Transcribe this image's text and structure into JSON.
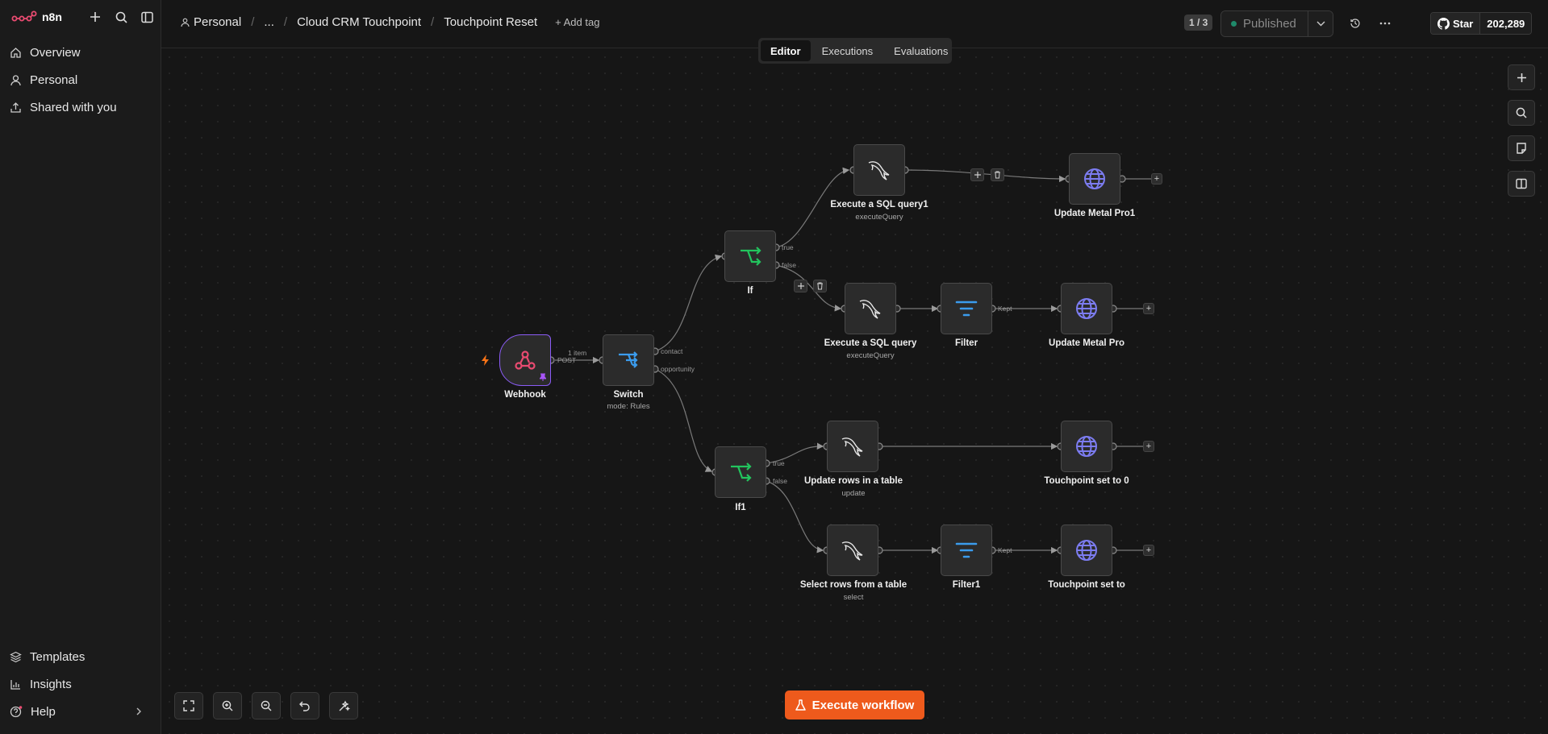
{
  "app": {
    "logo_text": "n8n"
  },
  "sidebar": {
    "items": [
      {
        "label": "Overview",
        "icon": "home-icon"
      },
      {
        "label": "Personal",
        "icon": "user-icon"
      },
      {
        "label": "Shared with you",
        "icon": "share-icon"
      }
    ],
    "bottom_items": [
      {
        "label": "Templates",
        "icon": "templates-icon"
      },
      {
        "label": "Insights",
        "icon": "insights-icon"
      },
      {
        "label": "Help",
        "icon": "help-icon"
      }
    ]
  },
  "header": {
    "breadcrumb": [
      "Personal",
      "...",
      "Cloud CRM Touchpoint",
      "Touchpoint Reset"
    ],
    "add_tag": "+ Add tag",
    "version": "1 / 3",
    "publish_label": "Published",
    "github_star": "Star",
    "github_count": "202,289"
  },
  "tabs": [
    "Editor",
    "Executions",
    "Evaluations"
  ],
  "nodes": {
    "webhook": {
      "label": "Webhook",
      "sub": ""
    },
    "switch": {
      "label": "Switch",
      "sub": "mode: Rules"
    },
    "if": {
      "label": "If",
      "sub": ""
    },
    "if1": {
      "label": "If1",
      "sub": ""
    },
    "sql1": {
      "label": "Execute a SQL query1",
      "sub": "executeQuery"
    },
    "sql": {
      "label": "Execute a SQL query",
      "sub": "executeQuery"
    },
    "filter": {
      "label": "Filter",
      "sub": ""
    },
    "filter1": {
      "label": "Filter1",
      "sub": ""
    },
    "update_metal_pro1": {
      "label": "Update Metal Pro1",
      "sub": ""
    },
    "update_metal_pro": {
      "label": "Update Metal Pro",
      "sub": ""
    },
    "update_rows": {
      "label": "Update rows in a table",
      "sub": "update"
    },
    "select_rows": {
      "label": "Select rows from a table",
      "sub": "select"
    },
    "touchpoint0": {
      "label": "Touchpoint set to 0",
      "sub": ""
    },
    "touchpoint": {
      "label": "Touchpoint set to",
      "sub": ""
    }
  },
  "ports": {
    "webhook_out": "POST",
    "webhook_items": "1 item",
    "switch_contact": "contact",
    "switch_opportunity": "opportunity",
    "if_true": "true",
    "if_false": "false",
    "if1_true": "true",
    "if1_false": "false",
    "filter_kept": "Kept",
    "filter1_kept": "Kept"
  },
  "execute_button": "Execute workflow",
  "colors": {
    "accent": "#ee5a1c",
    "webhook_border": "#8b5cf6",
    "if_icon": "#22c55e",
    "switch_icon": "#3b9ced",
    "http_icon": "#7c7cf0"
  }
}
